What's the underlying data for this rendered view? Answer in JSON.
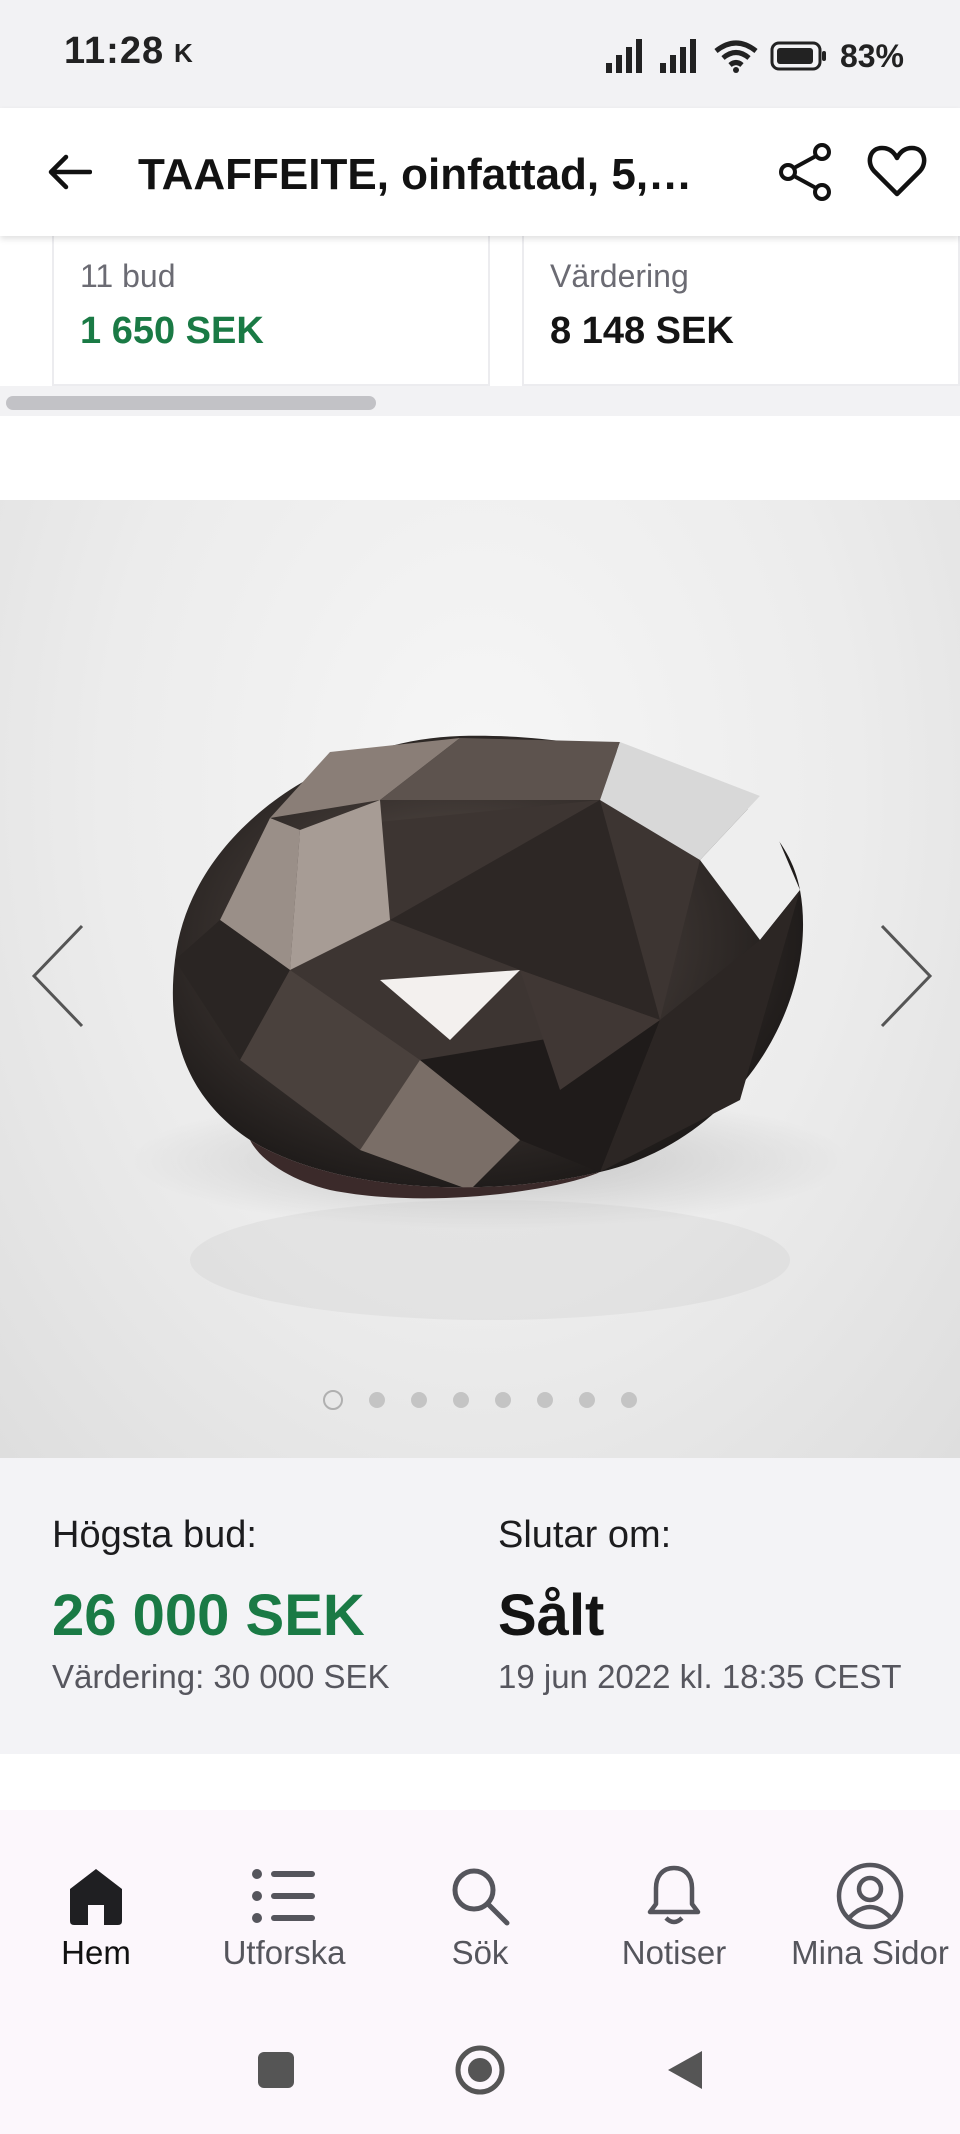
{
  "status_bar": {
    "time": "11:28",
    "indicator": "K",
    "battery": "83%",
    "icons": [
      "signal-icon",
      "signal-icon",
      "wifi-icon",
      "battery-icon"
    ]
  },
  "app_bar": {
    "title": "TAAFFEITE, oinfattad, 5,0...",
    "icons": [
      "back-arrow-icon",
      "share-icon",
      "heart-icon"
    ]
  },
  "related_cards": [
    {
      "label": "11 bud",
      "value": "1 650 SEK"
    },
    {
      "label": "Värdering",
      "value": "8 148 SEK"
    }
  ],
  "gallery": {
    "image_count": 8,
    "active_index": 0,
    "icons": [
      "chevron-left-icon",
      "chevron-right-icon"
    ]
  },
  "bid_info": {
    "highest_bid_label": "Högsta bud:",
    "highest_bid_value": "26 000 SEK",
    "valuation": "Värdering: 30 000 SEK",
    "ends_label": "Slutar om:",
    "status": "Sålt",
    "end_date": "19 jun 2022 kl. 18:35 CEST"
  },
  "bottom_nav": {
    "items": [
      {
        "label": "Hem",
        "icon": "home-icon",
        "active": true
      },
      {
        "label": "Utforska",
        "icon": "list-icon",
        "active": false
      },
      {
        "label": "Sök",
        "icon": "search-icon",
        "active": false
      },
      {
        "label": "Notiser",
        "icon": "bell-icon",
        "active": false
      },
      {
        "label": "Mina Sidor",
        "icon": "user-circle-icon",
        "active": false
      }
    ]
  },
  "colors": {
    "accent_green": "#1a7a45",
    "panel_bg": "#f3f3f6",
    "nav_bg": "#fcf7fc"
  }
}
